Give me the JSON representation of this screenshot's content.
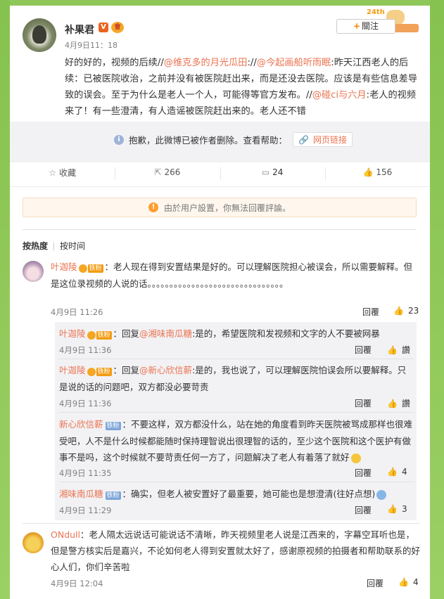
{
  "post": {
    "author": "补果君",
    "verified_badge": "V",
    "vip_badge": "會",
    "time": "4月9日11：18",
    "follow_label": "關注",
    "deco_text": "24th",
    "content_1": "好的好的，视频的后续//",
    "link_1": "@维克多的月光瓜田",
    "content_2": "://",
    "link_2": "@今起画船听雨眠",
    "content_3": ":昨天江西老人的后续：已被医院收治，之前并没有被医院赶出来，而是还没去医院。应该是有些信息差导致的误会。至于为什么是老人一个人，可能得等官方发布。//",
    "link_3": "@碰ci与六月",
    "content_4": ":老人的视频来了！有一些澄清，有人造谣被医院赶出来的。老人还不错"
  },
  "deleted_notice": {
    "text": "抱歉，此微博已被作者删除。查看帮助：",
    "help_link": "网页链接"
  },
  "actions": {
    "favorite": "收藏",
    "repost_count": "266",
    "comment_count": "24",
    "like_count": "156"
  },
  "notice": "由於用户設置，你無法回覆評論。",
  "sort": {
    "by_hot": "按热度",
    "by_time": "按时间"
  },
  "comments": [
    {
      "name": "叶迦陵",
      "badge": "铁粉",
      "text": "：老人现在得到安置结果是好的。可以理解医院担心被误会，所以需要解释。但是这位录视频的人说的话。。。。。。。。。。。。。。。。。。。。。。。。。。。。。。。",
      "time": "4月9日 11:26",
      "reply": "回覆",
      "likes": "23"
    },
    {
      "name": "ONdull",
      "text": "：老人隔太远说话可能说话不清晰，昨天视频里老人说是江西来的，字幕空耳听也是，但是警方核实后是嘉兴，不论如何老人得到安置就太好了，感谢原视频的拍摄者和帮助联系的好心人们，你们辛苦啦",
      "time": "4月9日 12:04",
      "reply": "回覆",
      "likes": "4"
    }
  ],
  "replies": [
    {
      "name": "叶迦陵",
      "badge": "铁粉",
      "prefix": "：回复",
      "target": "@湘味南瓜糖",
      "text": ":是的，希望医院和发视频和文字的人不要被网暴",
      "time": "4月9日 11:36",
      "reply": "回覆",
      "likes": "讚"
    },
    {
      "name": "叶迦陵",
      "badge": "铁粉",
      "prefix": "：回复",
      "target": "@新心欣信薪",
      "text": ":是的，我也说了，可以理解医院怕误会所以要解释。只是说的话的问题吧，双方都没必要苛责",
      "time": "4月9日 11:36",
      "reply": "回覆",
      "likes": "讚"
    },
    {
      "name": "新心欣信薪",
      "badge": "铁粉",
      "text": "：不要这样，双方都没什么，站在她的角度看到昨天医院被骂成那样也很难受吧，人不是什么时候都能随时保持理智说出很理智的话的，至少这个医院和这个医护有做事不是吗，这个时候就不要苛责任何一方了，问题解决了老人有着落了就好",
      "time": "4月9日 11:35",
      "reply": "回覆",
      "likes": "4"
    },
    {
      "name": "湘味南瓜糖",
      "badge": "铁粉",
      "text": "：确实，但老人被安置好了最重要，她可能也是想澄清(往好点想)",
      "time": "4月9日 11:29",
      "reply": "回覆",
      "likes": "3"
    }
  ]
}
